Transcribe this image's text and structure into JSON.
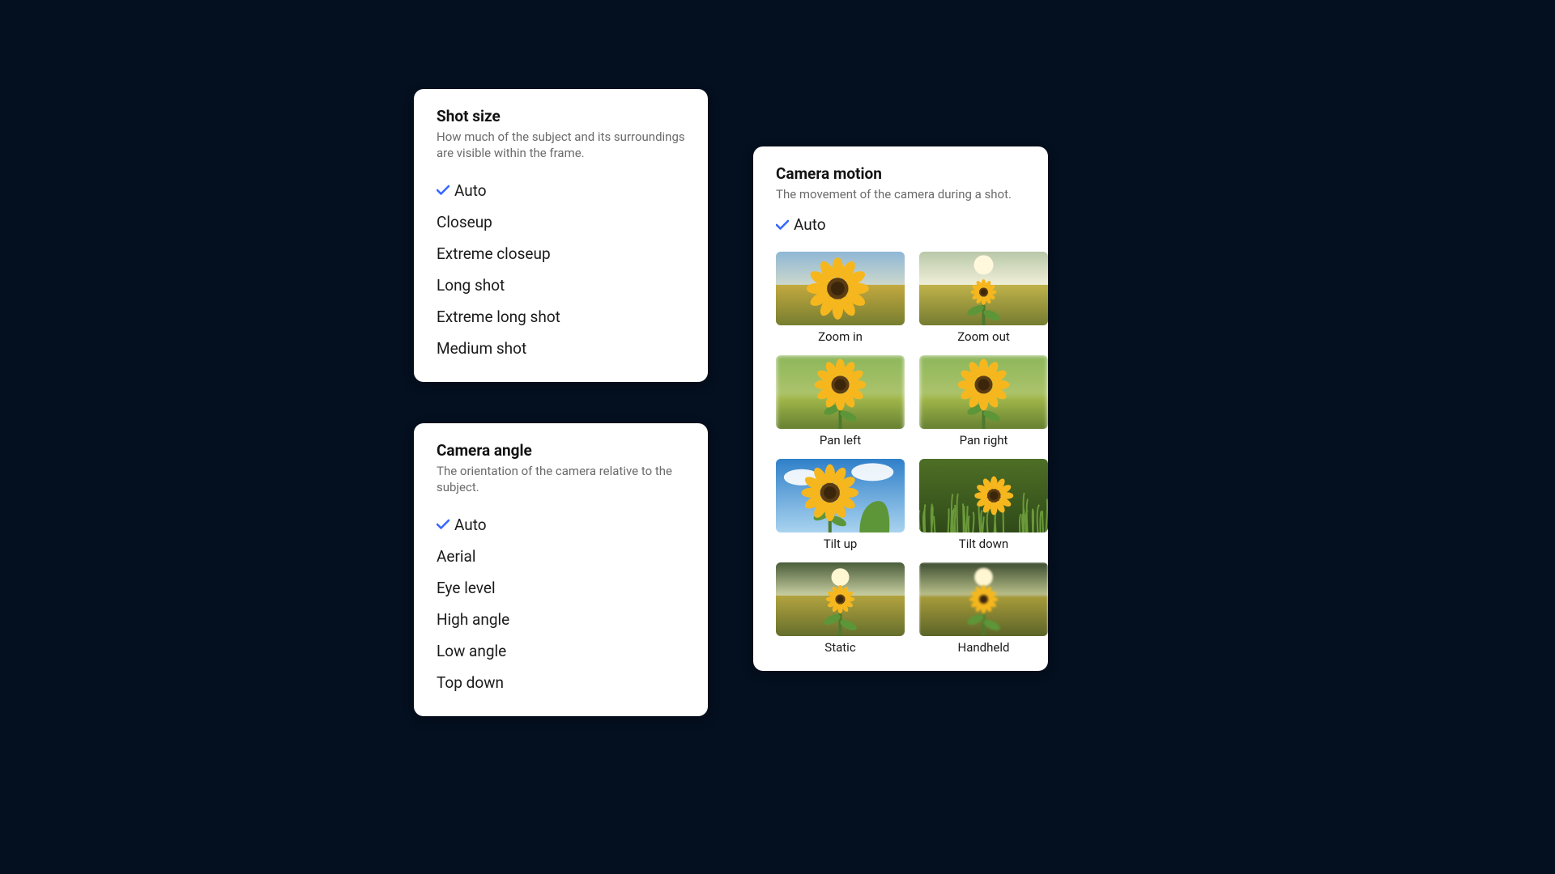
{
  "shot_size": {
    "title": "Shot size",
    "desc": "How much of the subject and its surroundings are visible within the frame.",
    "options": [
      {
        "label": "Auto",
        "selected": true
      },
      {
        "label": "Closeup",
        "selected": false
      },
      {
        "label": "Extreme closeup",
        "selected": false
      },
      {
        "label": "Long shot",
        "selected": false
      },
      {
        "label": "Extreme long shot",
        "selected": false
      },
      {
        "label": "Medium shot",
        "selected": false
      }
    ]
  },
  "camera_angle": {
    "title": "Camera angle",
    "desc": "The orientation of the camera relative to the subject.",
    "options": [
      {
        "label": "Auto",
        "selected": true
      },
      {
        "label": "Aerial",
        "selected": false
      },
      {
        "label": "Eye level",
        "selected": false
      },
      {
        "label": "High angle",
        "selected": false
      },
      {
        "label": "Low angle",
        "selected": false
      },
      {
        "label": "Top down",
        "selected": false
      }
    ]
  },
  "camera_motion": {
    "title": "Camera motion",
    "desc": "The movement of the camera during a shot.",
    "auto_label": "Auto",
    "auto_selected": true,
    "thumbs": [
      {
        "label": "Zoom in",
        "variant": "zoom-in"
      },
      {
        "label": "Zoom out",
        "variant": "zoom-out"
      },
      {
        "label": "Pan left",
        "variant": "pan-left"
      },
      {
        "label": "Pan right",
        "variant": "pan-right"
      },
      {
        "label": "Tilt up",
        "variant": "tilt-up"
      },
      {
        "label": "Tilt down",
        "variant": "tilt-down"
      },
      {
        "label": "Static",
        "variant": "static"
      },
      {
        "label": "Handheld",
        "variant": "handheld"
      }
    ]
  }
}
